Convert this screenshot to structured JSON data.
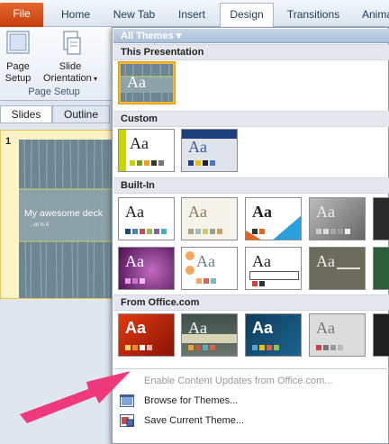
{
  "ribbon": {
    "tabs": [
      "File",
      "Home",
      "New Tab",
      "Insert",
      "Design",
      "Transitions",
      "Anima"
    ],
    "active_tab": "Design",
    "page_setup_label": "Page\nSetup",
    "slide_orientation_label": "Slide\nOrientation",
    "group_label": "Page Setup"
  },
  "left_pane": {
    "tab_slides": "Slides",
    "tab_outline": "Outline",
    "slide_number": "1",
    "slide_title": "My awesome deck",
    "slide_subtitle": "...or is it"
  },
  "themes_dropdown": {
    "header": "All Themes ▾",
    "sections": {
      "this_presentation": "This Presentation",
      "custom": "Custom",
      "built_in": "Built-In",
      "from_office": "From Office.com"
    },
    "sample_text": "Aa",
    "menu": {
      "enable_updates": "Enable Content Updates from Office.com...",
      "browse": "Browse for Themes...",
      "save": "Save Current Theme..."
    }
  },
  "colors": {
    "accent_orange": "#d94f16",
    "selection_gold": "#f2b632",
    "arrow_pink": "#ee3a7a"
  }
}
